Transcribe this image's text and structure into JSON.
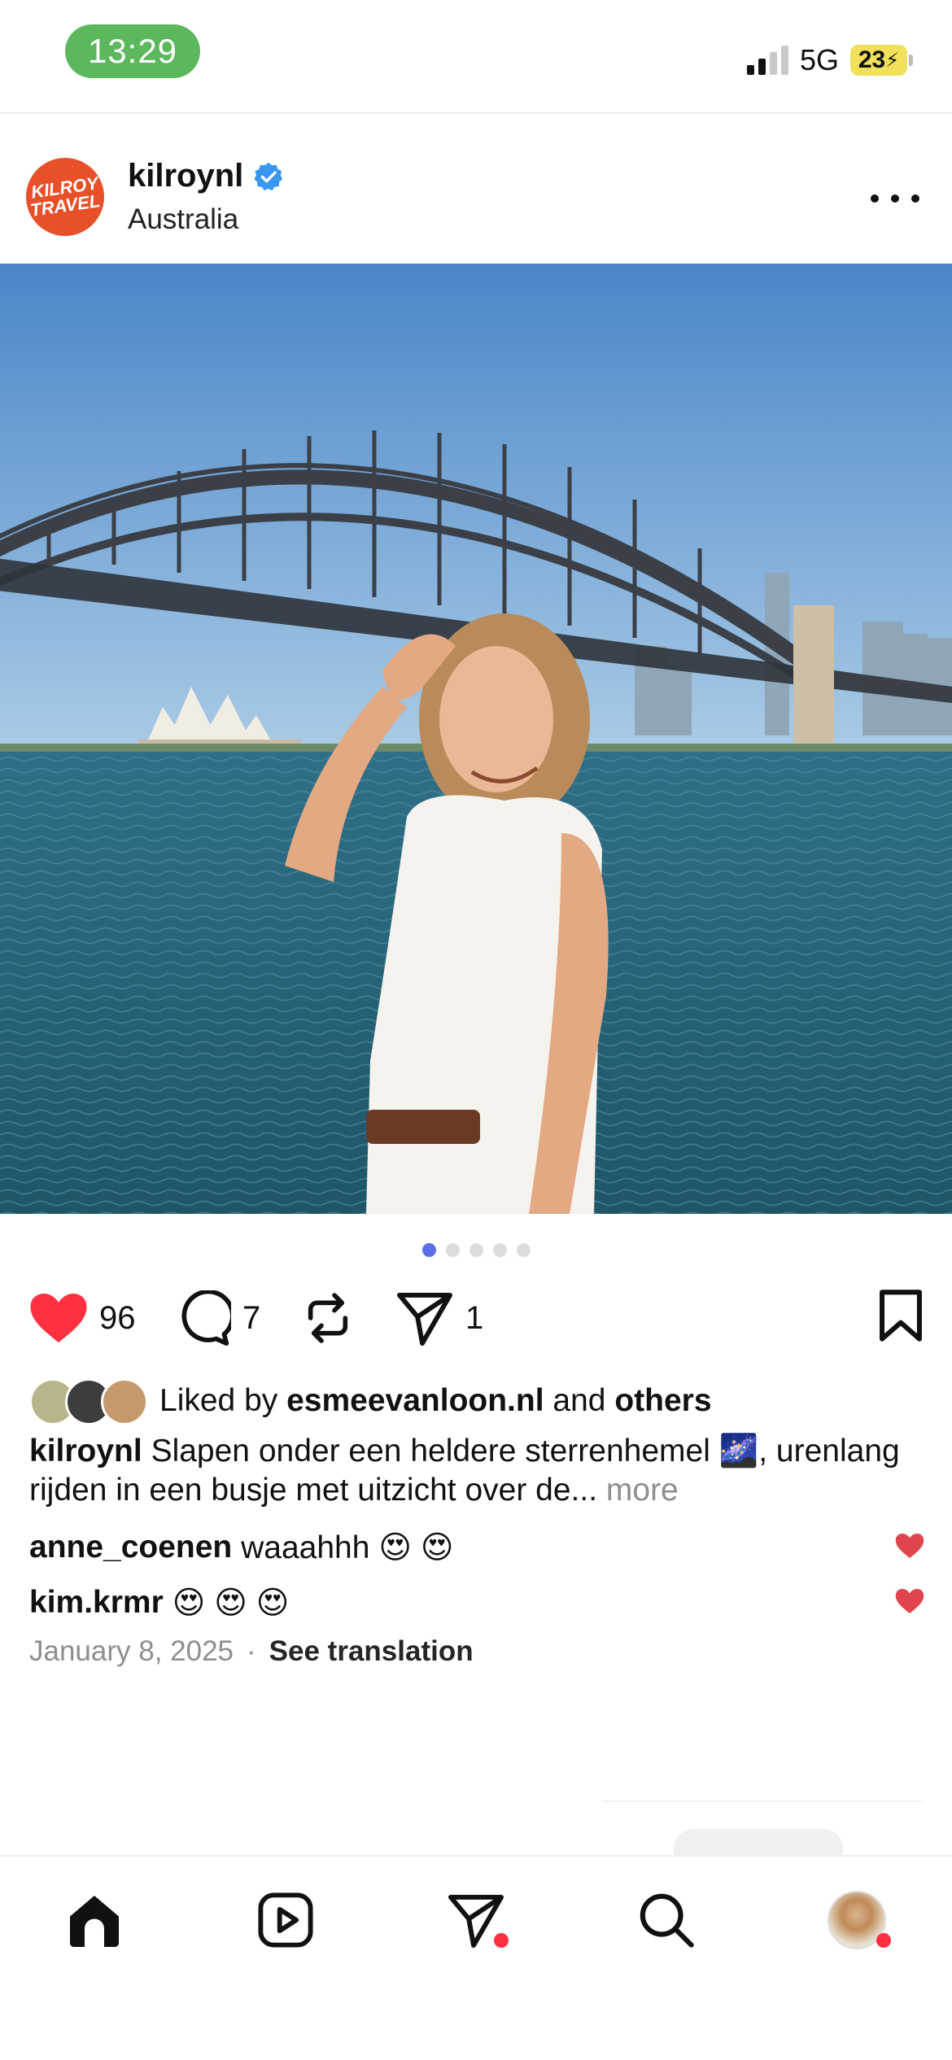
{
  "status_bar": {
    "time": "13:29",
    "network": "5G",
    "battery": "23"
  },
  "post": {
    "username": "kilroynl",
    "verified_icon": "verified-badge-icon",
    "location": "Australia",
    "avatar_text_1": "KILROY",
    "avatar_text_2": "TRAVEL",
    "image_description_icon": "photo",
    "carousel": {
      "total": 5,
      "active_index": 0
    },
    "actions": {
      "like_count": "96",
      "comment_count": "7",
      "share_count": "1"
    },
    "likes": {
      "prefix": "Liked by",
      "user": "esmeevanloon.nl",
      "and": "and",
      "others": "others"
    },
    "caption": {
      "user": "kilroynl",
      "text": "Slapen onder een heldere sterrenhemel 🌌, urenlang rijden in een busje met uitzicht over de...",
      "more": "more"
    },
    "comments": [
      {
        "user": "anne_coenen",
        "text": "waaahhh 😍 😍"
      },
      {
        "user": "kim.krmr",
        "text": "😍 😍 😍"
      }
    ],
    "date": "January 8, 2025",
    "separator": "·",
    "see_translation": "See translation"
  },
  "tabbar": {
    "items": [
      "home",
      "reels",
      "messages",
      "search",
      "profile"
    ]
  },
  "colors": {
    "like_red": "#ff3040",
    "accent_blue": "#5b6ee8",
    "verified_blue": "#3897f0",
    "time_pill": "#5cb85c"
  }
}
